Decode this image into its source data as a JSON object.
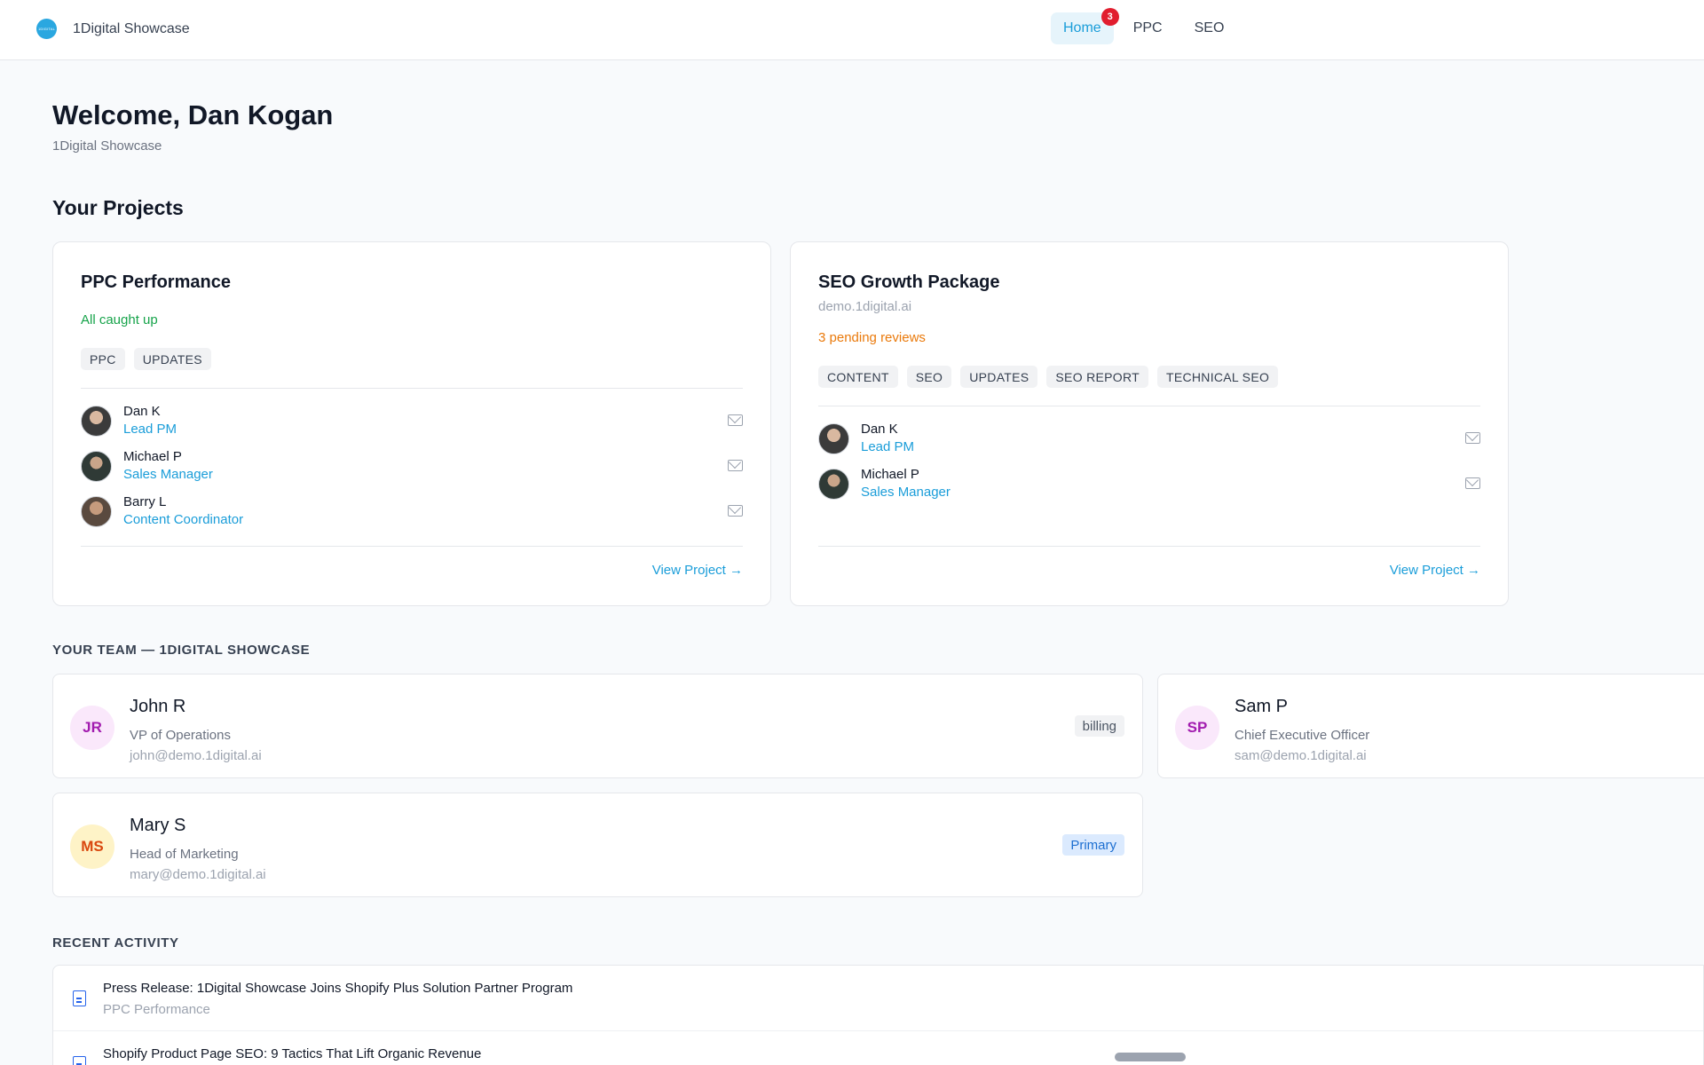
{
  "header": {
    "logo_text": "1DIGITAL",
    "brand": "1Digital Showcase",
    "nav": [
      {
        "label": "Home",
        "badge": "3",
        "active": true
      },
      {
        "label": "PPC"
      },
      {
        "label": "SEO"
      }
    ]
  },
  "welcome": {
    "title": "Welcome, Dan Kogan",
    "subtitle": "1Digital Showcase"
  },
  "projects": {
    "heading": "Your Projects",
    "items": [
      {
        "title": "PPC Performance",
        "status": "All caught up",
        "tags": [
          "PPC",
          "UPDATES"
        ],
        "members": [
          {
            "name": "Dan K",
            "role": "Lead PM"
          },
          {
            "name": "Michael P",
            "role": "Sales Manager"
          },
          {
            "name": "Barry L",
            "role": "Content Coordinator"
          }
        ],
        "link": "View Project →"
      },
      {
        "title": "SEO Growth Package",
        "domain": "demo.1digital.ai",
        "status": "3 pending reviews",
        "tags": [
          "CONTENT",
          "SEO",
          "UPDATES",
          "SEO REPORT",
          "TECHNICAL SEO"
        ],
        "members": [
          {
            "name": "Dan K",
            "role": "Lead PM"
          },
          {
            "name": "Michael P",
            "role": "Sales Manager"
          }
        ],
        "link": "View Project →"
      }
    ]
  },
  "team": {
    "heading": "YOUR TEAM — 1DIGITAL SHOWCASE",
    "members": [
      {
        "initials": "JR",
        "name": "John R",
        "role": "VP of Operations",
        "email": "john@demo.1digital.ai",
        "badge": "billing"
      },
      {
        "initials": "SP",
        "name": "Sam P",
        "role": "Chief Executive Officer",
        "email": "sam@demo.1digital.ai"
      },
      {
        "initials": "MS",
        "name": "Mary S",
        "role": "Head of Marketing",
        "email": "mary@demo.1digital.ai",
        "badge": "Primary"
      }
    ]
  },
  "activity": {
    "heading": "RECENT ACTIVITY",
    "items": [
      {
        "title": "Press Release: 1Digital Showcase Joins Shopify Plus Solution Partner Program",
        "project": "PPC Performance"
      },
      {
        "title": "Shopify Product Page SEO: 9 Tactics That Lift Organic Revenue",
        "project": ""
      }
    ]
  },
  "colors": {
    "accent": "#1a9dd9",
    "success": "#16a34a",
    "warning": "#ea7a0c",
    "badge_red": "#e11d2e"
  }
}
